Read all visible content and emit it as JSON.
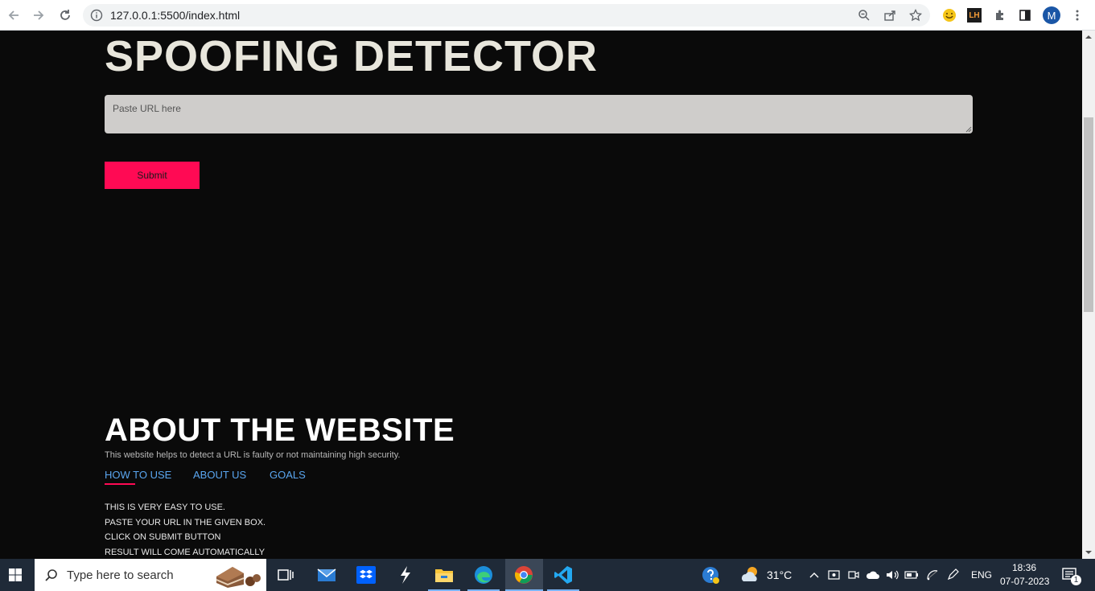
{
  "browser": {
    "url": "127.0.0.1:5500/index.html",
    "profile_initial": "M",
    "extension_label": "LH"
  },
  "page": {
    "title": "SPOOFING DETECTOR",
    "url_input": {
      "placeholder": "Paste URL here",
      "value": ""
    },
    "submit_label": "Submit",
    "about": {
      "title": "ABOUT THE WEBSITE",
      "description": "This website helps to detect a URL is faulty or not maintaining high security.",
      "tabs": [
        {
          "label": "HOW TO USE",
          "active": true
        },
        {
          "label": "ABOUT US",
          "active": false
        },
        {
          "label": "GOALS",
          "active": false
        }
      ],
      "content_lines": [
        "THIS IS VERY EASY TO USE.",
        "PASTE YOUR URL IN THE GIVEN BOX.",
        "CLICK ON SUBMIT BUTTON",
        "RESULT WILL COME AUTOMATICALLY"
      ]
    }
  },
  "colors": {
    "background": "#0a0a0a",
    "title": "#e8e6dc",
    "accent": "#ff0a54",
    "tab_link": "#5aa6f0"
  },
  "taskbar": {
    "search_placeholder": "Type here to search",
    "weather_temp": "31°C",
    "language": "ENG",
    "time": "18:36",
    "date": "07-07-2023",
    "notification_count": "1"
  }
}
